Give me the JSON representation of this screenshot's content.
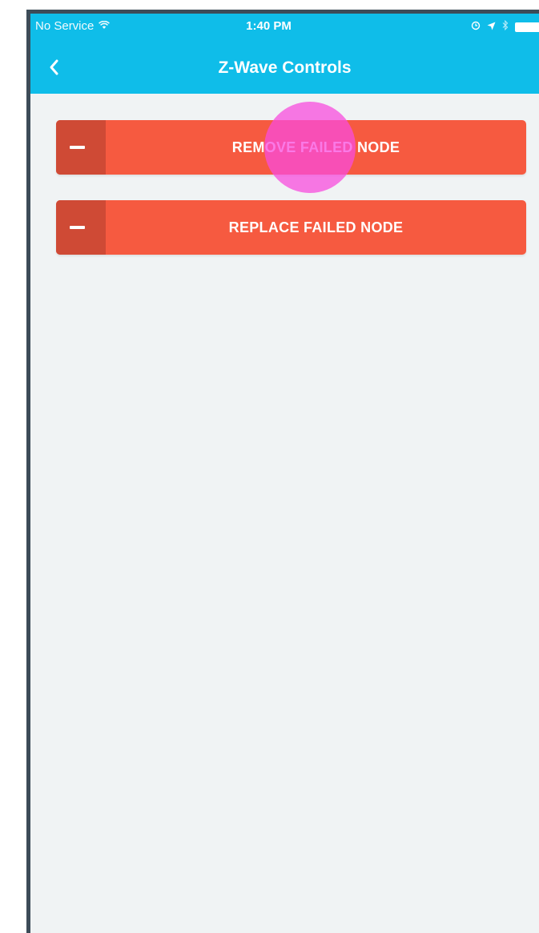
{
  "status_bar": {
    "carrier": "No Service",
    "time": "1:40 PM",
    "icons": [
      "wifi-icon",
      "alarm-icon",
      "location-arrow-icon",
      "bluetooth-icon",
      "battery-icon"
    ]
  },
  "nav": {
    "back_icon": "chevron-left-icon",
    "title": "Z-Wave Controls"
  },
  "actions": [
    {
      "label": "REMOVE FAILED NODE",
      "icon": "minus-icon"
    },
    {
      "label": "REPLACE FAILED NODE",
      "icon": "minus-icon"
    }
  ],
  "colors": {
    "header": "#0fbde9",
    "button": "#f65a40",
    "button_icon_box": "#cf4a35",
    "background": "#f0f3f4",
    "touch_indicator": "#f84cde"
  }
}
